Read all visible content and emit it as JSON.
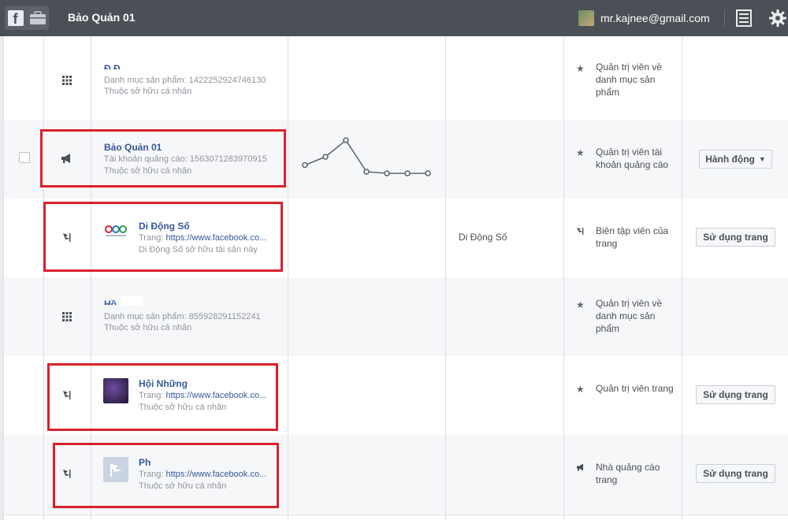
{
  "topbar": {
    "page_name": "Bảo Quản 01",
    "user_email": "mr.kajnee@gmail.com",
    "icons": [
      "facebook-icon",
      "briefcase-icon",
      "list-icon",
      "gear-icon"
    ]
  },
  "rows": [
    {
      "name": "",
      "line1": "Danh mục sản phẩm: 1422252924746130",
      "line2": "Thuộc sở hữu cá nhân",
      "role": "Quản trị viên về danh mục sản phẩm"
    },
    {
      "name": "Bảo Quản 01",
      "line1": "Tài khoản quảng cáo: 1563071283970915",
      "line2": "Thuộc sở hữu cá nhân",
      "role": "Quản trị viên tài khoản quảng cáo",
      "button": "Hành động"
    },
    {
      "name": "Di Động Số",
      "line1_prefix": "Trang: ",
      "line1_link": "https://www.facebook.co...",
      "line2": "Di Động Số sở hữu tài sản này",
      "business": "Di Động Số",
      "role": "Biên tập viên của trang",
      "button": "Sử dụng trang"
    },
    {
      "name": "",
      "line1": "Danh mục sản phẩm: 855928291152241",
      "line2": "Thuộc sở hữu cá nhân",
      "role": "Quản trị viên về danh mục sản phẩm"
    },
    {
      "name": "Hội Những",
      "line1_prefix": "Trang: ",
      "line1_link": "https://www.facebook.co...",
      "line2": "Thuộc sở hữu cá nhân",
      "role": "Quản trị viên trang",
      "button": "Sử dụng trang"
    },
    {
      "name": "Ph",
      "line1_prefix": "Trang: ",
      "line1_link": "https://www.facebook.co...",
      "line2": "Thuộc sở hữu cá nhân",
      "role": "Nhà quảng cáo trang",
      "button": "Sử dụng trang"
    }
  ],
  "sparkline": [
    1,
    2,
    4,
    0.2,
    0,
    0,
    0
  ],
  "colors": {
    "highlight": "#d9212d",
    "link": "#365899",
    "topbar": "#4b4f56"
  }
}
